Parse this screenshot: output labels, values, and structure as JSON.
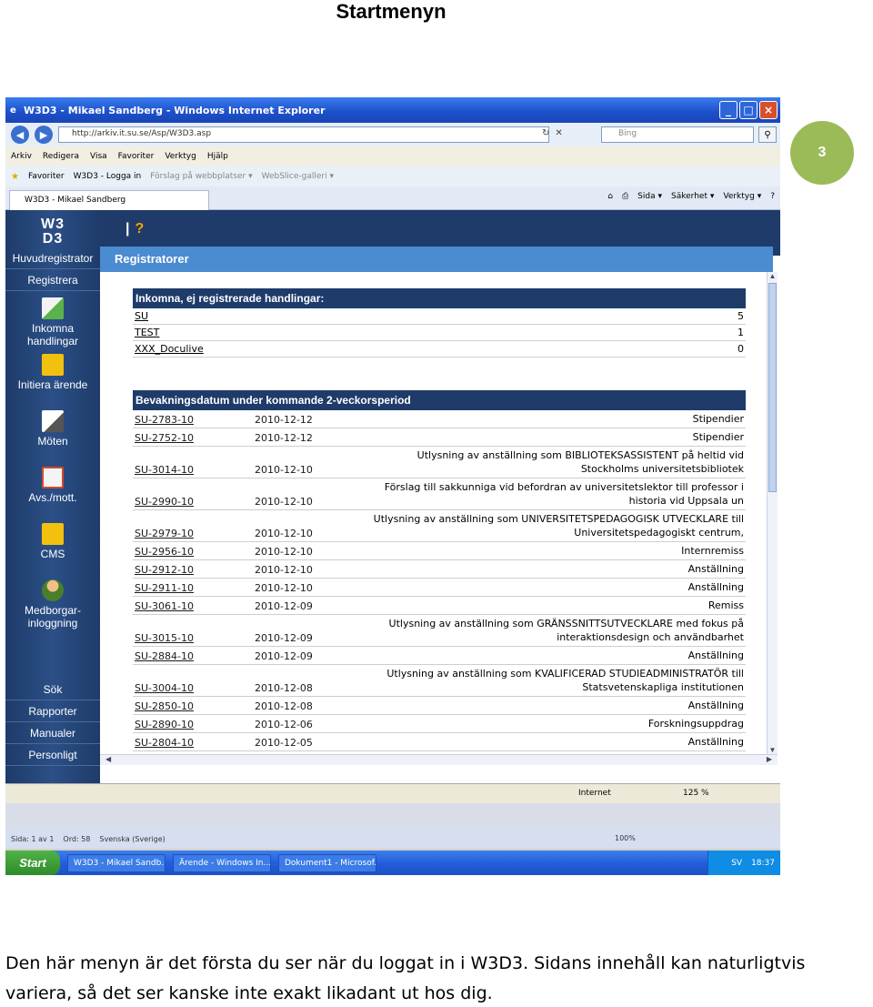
{
  "doc": {
    "title": "Startmenyn",
    "page_number": "3",
    "caption": "Den här menyn är det första du ser när du loggat in i W3D3. Sidans innehåll kan naturligtvis variera, så det ser kanske inte exakt likadant ut hos dig."
  },
  "browser": {
    "title": "W3D3 - Mikael Sandberg - Windows Internet Explorer",
    "address": "http://arkiv.it.su.se/Asp/W3D3.asp",
    "search_placeholder": "Bing",
    "menu": [
      "Arkiv",
      "Redigera",
      "Visa",
      "Favoriter",
      "Verktyg",
      "Hjälp"
    ],
    "favorites": [
      "Favoriter",
      "W3D3 - Logga in",
      "Förslag på webbplatser ▾",
      "WebSlice-galleri ▾"
    ],
    "tab_label": "W3D3 - Mikael Sandberg",
    "commands": [
      "Sida ▾",
      "Säkerhet ▾",
      "Verktyg ▾"
    ],
    "status_zone": "Internet",
    "zoom": "125 %"
  },
  "app": {
    "logo_line1": "W3",
    "logo_line2": "D3",
    "help_label": "?",
    "section_title": "Registratorer",
    "sidebar_top": [
      "Huvudregistrator",
      "Registrera"
    ],
    "sidebar_items": [
      {
        "label": "Inkomna handlingar",
        "icon": "inbox-icon"
      },
      {
        "label": "Initiera ärende",
        "icon": "new-folder-icon"
      },
      {
        "label": "Möten",
        "icon": "pen-icon"
      },
      {
        "label": "Avs./mott.",
        "icon": "contact-card-icon"
      },
      {
        "label": "CMS",
        "icon": "folders-icon"
      },
      {
        "label": "Medborgar-",
        "label2": "inloggning",
        "icon": "citizen-icon"
      }
    ],
    "sidebar_bottom": [
      "Sök",
      "Rapporter",
      "Manualer",
      "Personligt"
    ]
  },
  "incoming": {
    "header": "Inkomna, ej registrerade handlingar:",
    "rows": [
      {
        "name": "SU",
        "count": "5"
      },
      {
        "name": "TEST",
        "count": "1"
      },
      {
        "name": "XXX_Doculive",
        "count": "0"
      }
    ]
  },
  "deadlines": {
    "header": "Bevakningsdatum under kommande 2-veckorsperiod",
    "rows": [
      {
        "code": "SU-2783-10",
        "date": "2010-12-12",
        "title": "Stipendier"
      },
      {
        "code": "SU-2752-10",
        "date": "2010-12-12",
        "title": "Stipendier"
      },
      {
        "code": "SU-3014-10",
        "date": "2010-12-10",
        "title": "Utlysning av anställning som BIBLIOTEKSASSISTENT på heltid vid Stockholms universitetsbibliotek"
      },
      {
        "code": "SU-2990-10",
        "date": "2010-12-10",
        "title": "Förslag till sakkunniga vid befordran av universitetslektor till professor i historia vid Uppsala un"
      },
      {
        "code": "SU-2979-10",
        "date": "2010-12-10",
        "title": "Utlysning av anställning som UNIVERSITETSPEDAGOGISK UTVECKLARE till Universitetspedagogiskt centrum,"
      },
      {
        "code": "SU-2956-10",
        "date": "2010-12-10",
        "title": "Internremiss"
      },
      {
        "code": "SU-2912-10",
        "date": "2010-12-10",
        "title": "Anställning"
      },
      {
        "code": "SU-2911-10",
        "date": "2010-12-10",
        "title": "Anställning"
      },
      {
        "code": "SU-3061-10",
        "date": "2010-12-09",
        "title": "Remiss"
      },
      {
        "code": "SU-3015-10",
        "date": "2010-12-09",
        "title": "Utlysning av anställning som GRÄNSSNITTSUTVECKLARE med fokus på interaktionsdesign och användbarhet"
      },
      {
        "code": "SU-2884-10",
        "date": "2010-12-09",
        "title": "Anställning"
      },
      {
        "code": "SU-3004-10",
        "date": "2010-12-08",
        "title": "Utlysning av anställning som KVALIFICERAD STUDIEADMINISTRATÖR till Statsvetenskapliga institutionen"
      },
      {
        "code": "SU-2850-10",
        "date": "2010-12-08",
        "title": "Anställning"
      },
      {
        "code": "SU-2890-10",
        "date": "2010-12-06",
        "title": "Forskningsuppdrag"
      },
      {
        "code": "SU-2804-10",
        "date": "2010-12-05",
        "title": "Anställning"
      }
    ]
  },
  "word": {
    "page_info": "Sida: 1 av 1",
    "words": "Ord: 58",
    "language": "Svenska (Sverige)",
    "zoom": "100%"
  },
  "taskbar": {
    "start": "Start",
    "tasks": [
      "W3D3 - Mikael Sandb...",
      "Ärende - Windows In...",
      "Dokument1 - Microsof..."
    ],
    "lang": "SV",
    "clock": "18:37"
  },
  "colors": {
    "app_navy": "#1e3b6a",
    "app_blue": "#4b8bd0",
    "badge_green": "#9bbb59"
  }
}
